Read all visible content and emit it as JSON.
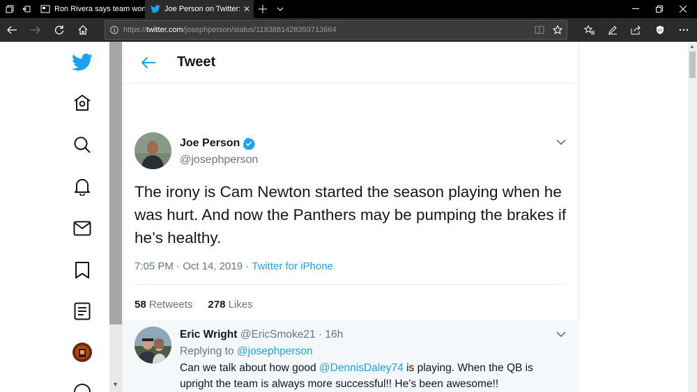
{
  "browser": {
    "tabs": [
      {
        "title": "Ron Rivera says team won't",
        "active": false
      },
      {
        "title": "Joe Person on Twitter: “",
        "active": true
      }
    ],
    "url_prefix": "https://",
    "url_host": "twitter.com",
    "url_path": "/josephperson/status/1183881428393713664"
  },
  "header": {
    "title": "Tweet"
  },
  "tweet": {
    "name": "Joe Person",
    "handle": "@josephperson",
    "text": "The irony is Cam Newton started the season playing when he was hurt. And now the Panthers may be pumping the brakes if he’s healthy.",
    "time": "7:05 PM · Oct 14, 2019 · ",
    "source": "Twitter for iPhone",
    "retweets_count": "58",
    "retweets_label": "Retweets",
    "likes_count": "278",
    "likes_label": "Likes"
  },
  "reply": {
    "name": "Eric Wright",
    "handle_time": "@EricSmoke21 · 16h",
    "replying_prefix": "Replying to ",
    "replying_handle": "@josephperson",
    "text_1a": "Can we talk about how good ",
    "mention": "@DennisDaley74",
    "text_1b": " is playing. When the QB is",
    "text_2": "upright the team is always more successful!! He’s been awesome!!"
  },
  "colors": {
    "accent": "#1da1f2",
    "text": "#14171a",
    "muted": "#657786",
    "chrome_dark": "#2b2b2b"
  },
  "icons": [
    "twitter-logo-icon",
    "home-icon",
    "search-icon",
    "bell-icon",
    "mail-icon",
    "bookmark-icon",
    "list-icon",
    "back-arrow-icon",
    "verified-icon",
    "chevron-down-icon",
    "reply-icon",
    "retweet-icon",
    "like-icon",
    "share-icon"
  ]
}
